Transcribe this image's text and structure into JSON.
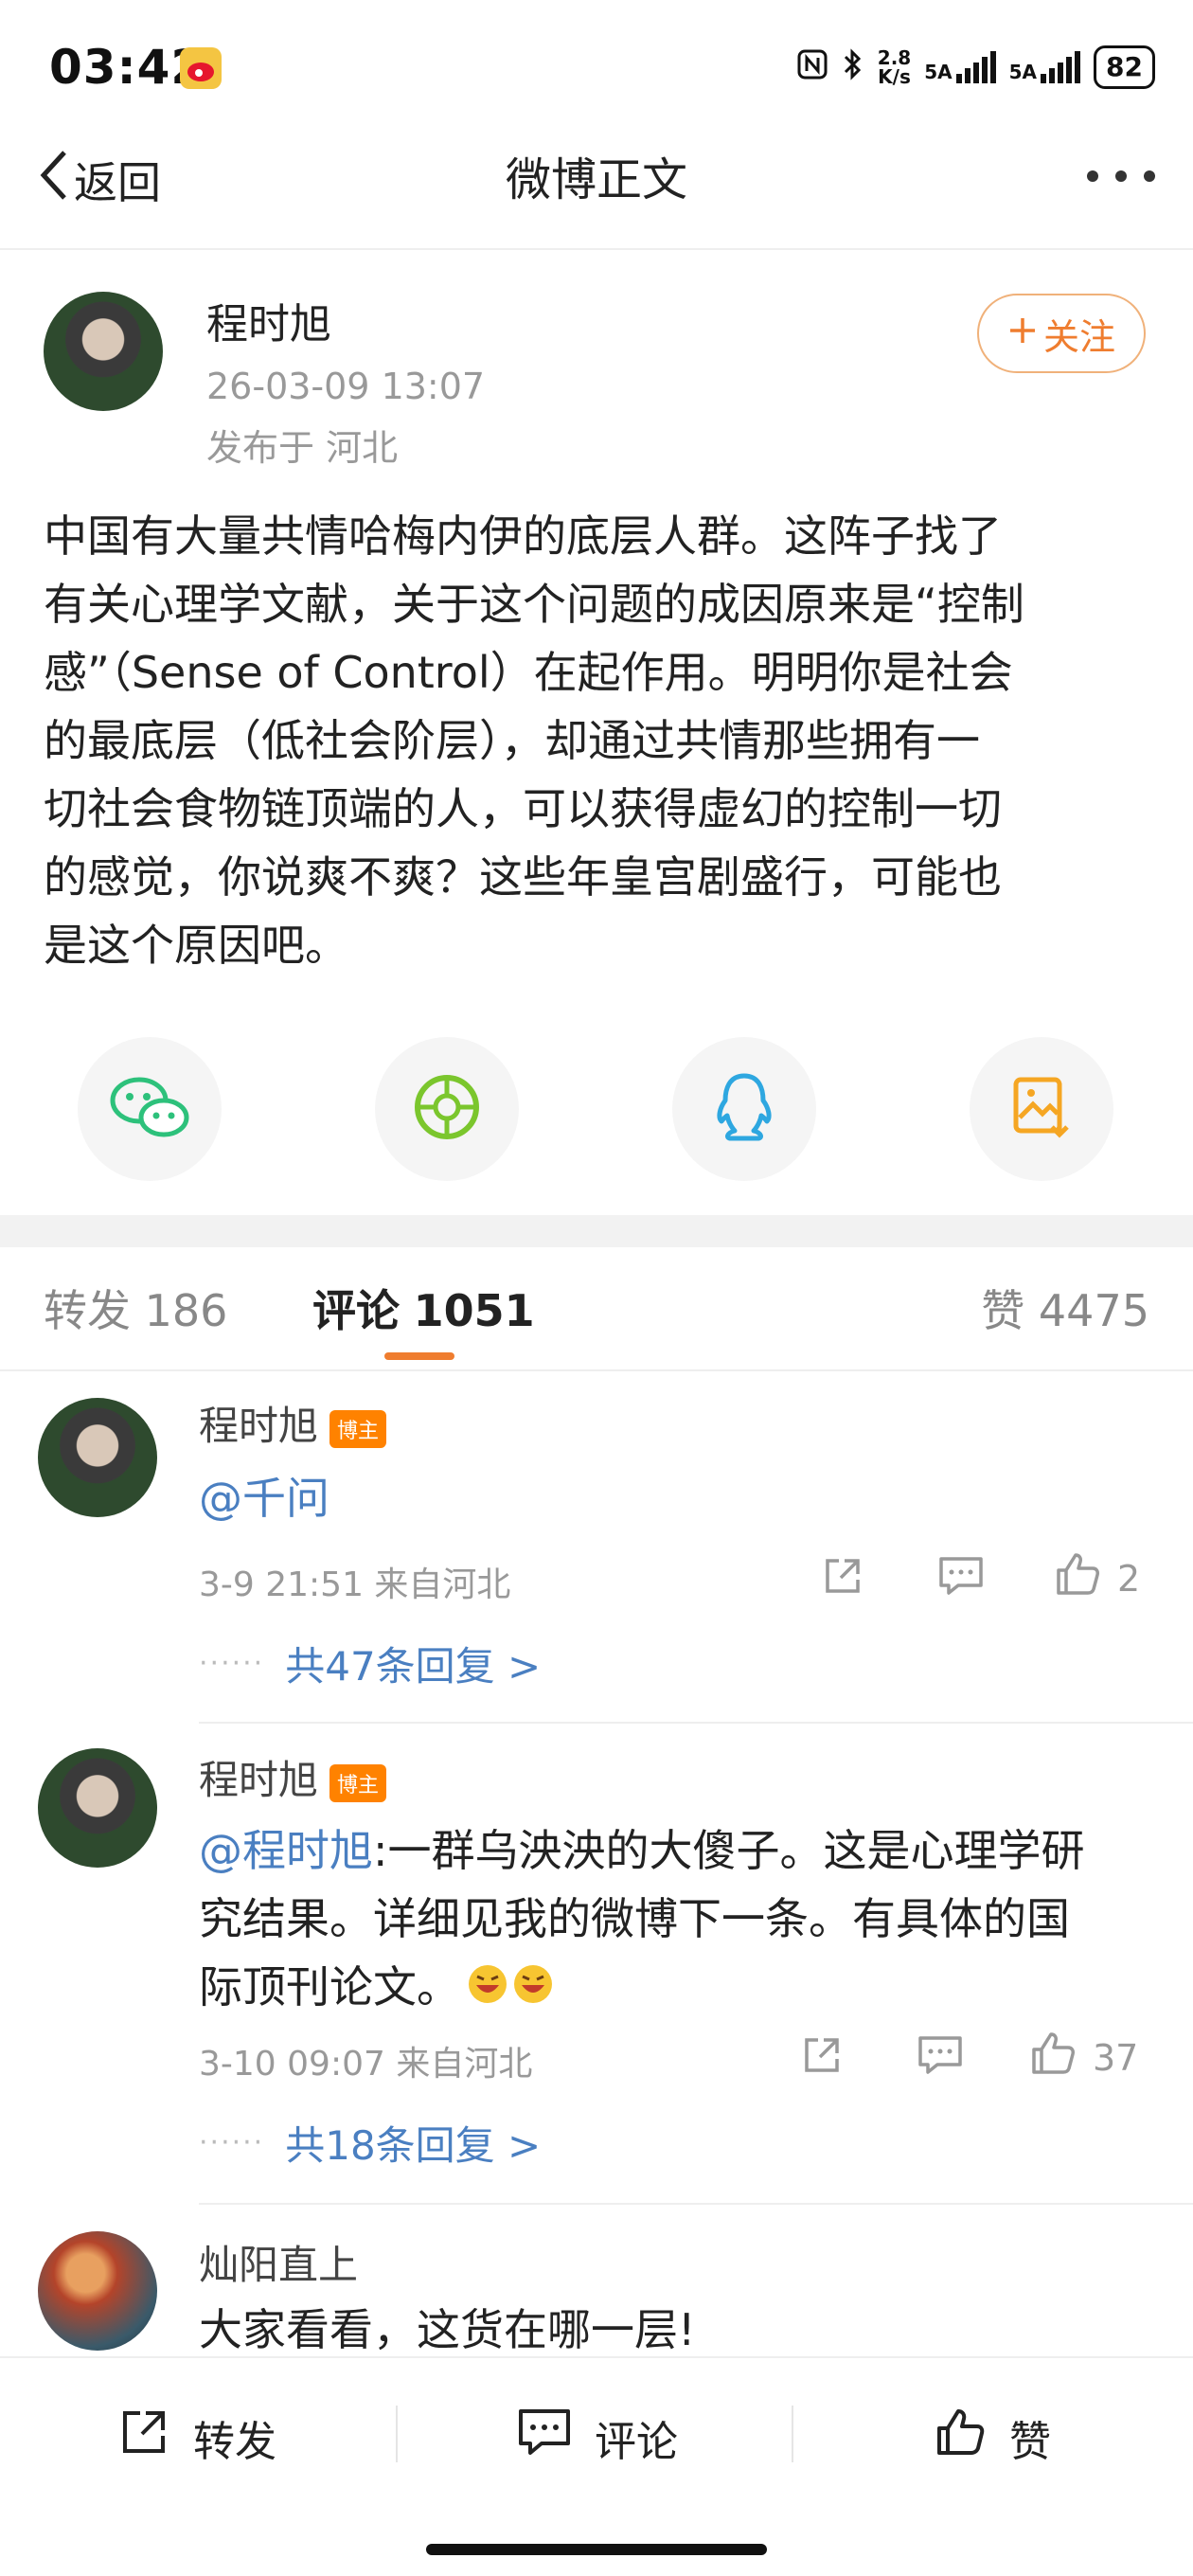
{
  "status_bar": {
    "time": "03:42",
    "network_speed_value": "2.8",
    "network_speed_unit": "K/s",
    "sim1": "5A",
    "sim2": "5A",
    "battery": "82"
  },
  "nav": {
    "back_label": "返回",
    "title": "微博正文"
  },
  "post": {
    "author": "程时旭",
    "time": "26-03-09 13:07",
    "location": "发布于 河北",
    "follow_label": "关注",
    "lines": [
      "中国有大量共情哈梅内伊的底层人群。这阵子找了",
      "有关心理学文献，关于这个问题的成因原来是“控制",
      "感”（Sense of Control）在起作用。明明你是社会",
      "的最底层（低社会阶层），却通过共情那些拥有一",
      "切社会食物链顶端的人，可以获得虚幻的控制一切",
      "的感觉，你说爽不爽？这些年皇宫剧盛行，可能也",
      "是这个原因吧。"
    ]
  },
  "share": {
    "icons": [
      "wechat-icon",
      "moments-icon",
      "qq-icon",
      "save-image-icon"
    ]
  },
  "tabs": {
    "repost": "转发 186",
    "comment_label": "评论",
    "comment_count": "1051",
    "like": "赞 4475"
  },
  "comments": [
    {
      "name": "程时旭",
      "badge": "博主",
      "mention": "@千问",
      "text": "",
      "meta": "3-9 21:51 来自河北",
      "likes": "2",
      "replies": "共47条回复 >"
    },
    {
      "name": "程时旭",
      "badge": "博主",
      "mention": "@程时旭",
      "text_lines": [
        ":一群乌泱泱的大傻子。这是心理学研",
        "究结果。详细见我的微博下一条。有具体的国",
        "际顶刊论文。"
      ],
      "meta": "3-10 09:07 来自河北",
      "likes": "37",
      "replies": "共18条回复 >"
    },
    {
      "name": "灿阳直上",
      "text": "大家看看，这货在哪一层!"
    }
  ],
  "bottom_bar": {
    "repost": "转发",
    "comment": "评论",
    "like": "赞"
  },
  "colors": {
    "accent": "#ef7d2f",
    "link": "#4a7fc1",
    "badge": "#ff8200"
  }
}
